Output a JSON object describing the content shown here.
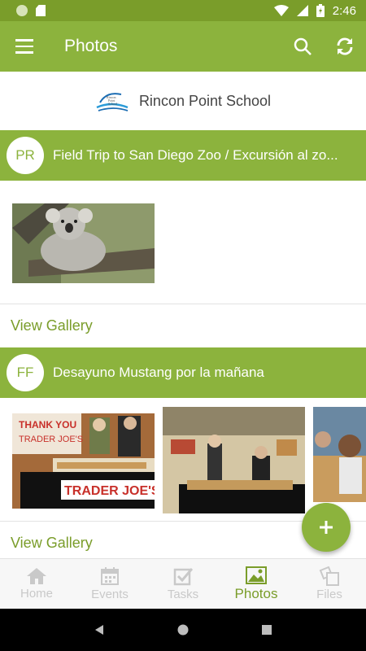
{
  "status_bar": {
    "time": "2:46"
  },
  "app_bar": {
    "title": "Photos"
  },
  "school": {
    "name": "Rincon Point School",
    "logo_text": [
      "Rincon",
      "Point",
      "School"
    ]
  },
  "posts": [
    {
      "initials": "PR",
      "title": "Field Trip to San Diego Zoo  / Excursión al zo...",
      "view_gallery": "View Gallery"
    },
    {
      "initials": "FF",
      "title": "Desayuno Mustang por la mañana",
      "view_gallery": "View Gallery",
      "photo_sign_text": "TRADER JOE'S",
      "photo_banner_text": "THANK YOU TRADER JOE'S"
    }
  ],
  "bottom_nav": {
    "items": [
      {
        "label": "Home",
        "icon": "home-icon"
      },
      {
        "label": "Events",
        "icon": "calendar-icon"
      },
      {
        "label": "Tasks",
        "icon": "checkbox-icon"
      },
      {
        "label": "Photos",
        "icon": "image-icon",
        "active": true
      },
      {
        "label": "Files",
        "icon": "files-icon"
      }
    ]
  },
  "colors": {
    "primary": "#8cb33d",
    "primary_dark": "#7a9d2a",
    "inactive": "#c9c9c9"
  }
}
